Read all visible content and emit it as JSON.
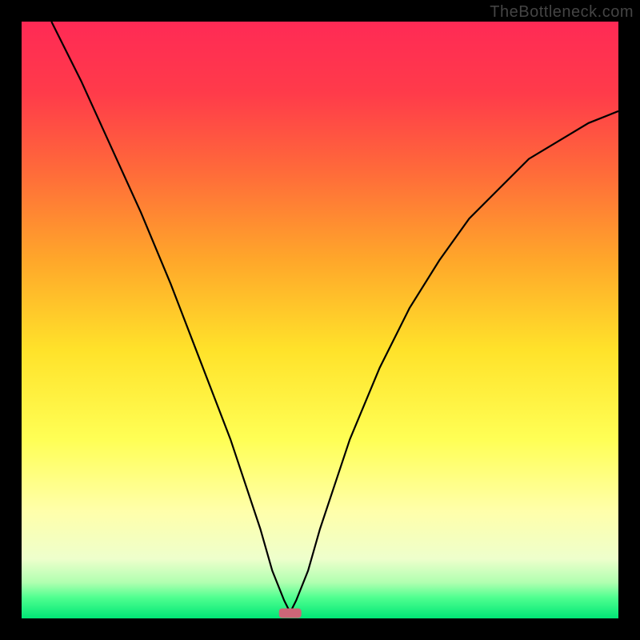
{
  "watermark": "TheBottleneck.com",
  "chart_data": {
    "type": "line",
    "title": "",
    "xlabel": "",
    "ylabel": "",
    "xlim": [
      0,
      100
    ],
    "ylim": [
      0,
      100
    ],
    "background_gradient": {
      "stops": [
        {
          "offset": 0.0,
          "color": "#ff2a55"
        },
        {
          "offset": 0.12,
          "color": "#ff3b4a"
        },
        {
          "offset": 0.25,
          "color": "#ff6a3a"
        },
        {
          "offset": 0.4,
          "color": "#ffa72a"
        },
        {
          "offset": 0.55,
          "color": "#ffe22a"
        },
        {
          "offset": 0.7,
          "color": "#ffff55"
        },
        {
          "offset": 0.82,
          "color": "#ffffaa"
        },
        {
          "offset": 0.9,
          "color": "#eeffcc"
        },
        {
          "offset": 0.94,
          "color": "#b0ffb0"
        },
        {
          "offset": 0.965,
          "color": "#50ff90"
        },
        {
          "offset": 1.0,
          "color": "#00e676"
        }
      ]
    },
    "series": [
      {
        "name": "bottleneck-curve",
        "x": [
          5,
          10,
          15,
          20,
          25,
          30,
          35,
          40,
          42,
          44,
          45,
          46,
          48,
          50,
          55,
          60,
          65,
          70,
          75,
          80,
          85,
          90,
          95,
          100
        ],
        "y": [
          100,
          90,
          79,
          68,
          56,
          43,
          30,
          15,
          8,
          3,
          1,
          3,
          8,
          15,
          30,
          42,
          52,
          60,
          67,
          72,
          77,
          80,
          83,
          85
        ]
      }
    ],
    "marker": {
      "x": 45,
      "y": 1,
      "color": "#cc6677",
      "shape": "rounded-rect"
    }
  }
}
